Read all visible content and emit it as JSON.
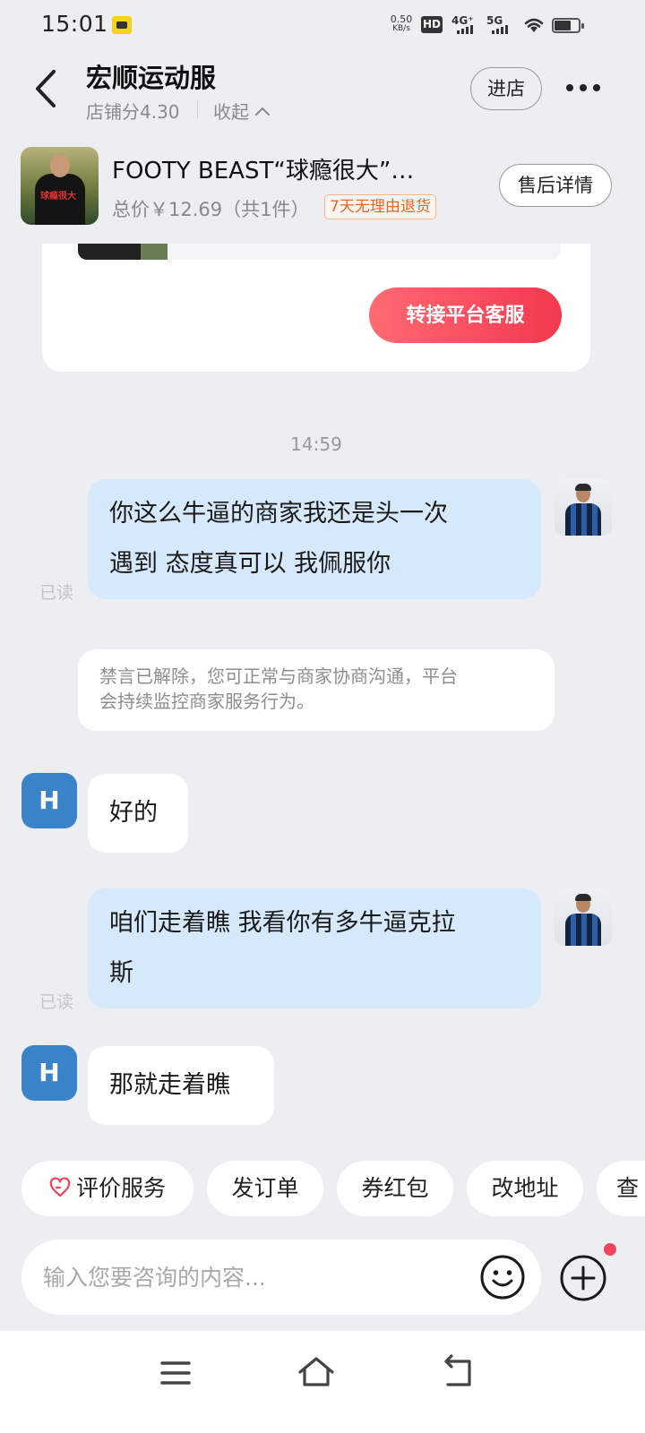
{
  "status": {
    "time": "15:01",
    "speed_value": "0.50",
    "speed_unit": "KB/s",
    "hd": "HD",
    "net1": "4G⁺",
    "net2": "5G"
  },
  "header": {
    "shop_name": "宏顺运动服",
    "score": "店铺分4.30",
    "collapse": "收起",
    "enter_store": "进店"
  },
  "product": {
    "shirt_text": "球瘾很大",
    "title": "FOOTY BEAST“球瘾很大”…",
    "price": "总价￥12.69（共1件）",
    "return_badge": "7天无理由退货",
    "aftersale": "售后详情"
  },
  "card": {
    "transfer_button": "转接平台客服"
  },
  "timestamp": "14:59",
  "messages": {
    "m1_line1": "你这么牛逼的商家我还是头一次",
    "m1_line2": "遇到 态度真可以 我佩服你",
    "read": "已读",
    "notice_line1": "禁言已解除，您可正常与商家协商沟通，平台",
    "notice_line2": "会持续监控商家服务行为。",
    "merchant_initial": "H",
    "m2": "好的",
    "m3_line1": "咱们走着瞧 我看你有多牛逼克拉",
    "m3_line2": "斯",
    "m4": "那就走着瞧"
  },
  "quick_actions": [
    "评价服务",
    "发订单",
    "券红包",
    "改地址",
    "查"
  ],
  "input": {
    "placeholder": "输入您要咨询的内容..."
  },
  "icons": {
    "back": "chevron-left-icon",
    "more": "more-dots-icon",
    "emoji": "smiley-icon",
    "plus": "plus-circle-icon",
    "heart": "heart-icon"
  },
  "colors": {
    "accent_red": "#f3384f",
    "out_bubble": "#d6e9fb",
    "merchant_avatar": "#3b83c8",
    "badge_orange": "#e4662b"
  }
}
